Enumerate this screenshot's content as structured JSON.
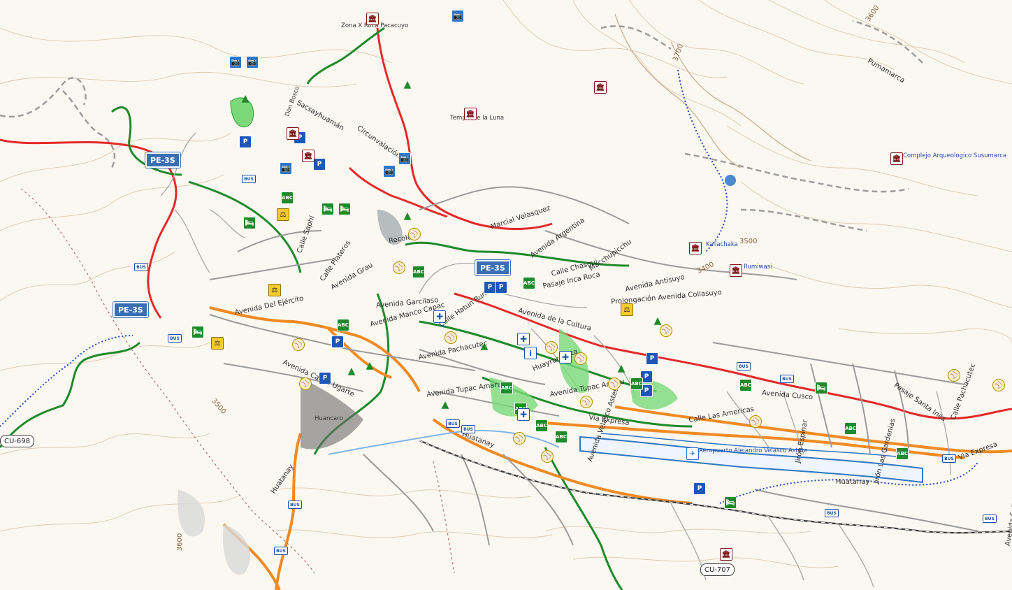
{
  "map": {
    "colors": {
      "background": "#fbf8f1",
      "contour": "#d9c3a7",
      "road_minor": "#9b9b9b",
      "road_green": "#1e8a2a",
      "road_orange": "#f08a24",
      "road_red": "#e4292a",
      "rail": "#3a3a3a",
      "water_blue": "#7fb6e8",
      "airport_blue": "#2e76c8"
    },
    "labels": {
      "zona": "Zona X Roca Pacacuyo",
      "don_bosco": "Don Bosco",
      "sacsayhuaman": "Sacsayhuamán",
      "circunvalacion": "Circunvalación",
      "templo_luna": "Templo de la Luna",
      "manuel_velasquez": "Marcial Velasquez",
      "av_argentina": "Avenida Argentina",
      "macchu_picchu": "Macchupicchu",
      "calle_chasqui": "Calle Chasqui",
      "pasaje_inca_roca": "Pasaje Inca Roca",
      "prolongacion_collasuyo": "Prolongación Avenida Collasuyo",
      "av_antisuyo": "Avenida Antisuyo",
      "av_del_ejercito": "Avenida Del Ejército",
      "av_carlos_ugarte": "Avenida Carlos Ugarte",
      "av_tupac_amaru": "Avenida Tupac Amaru",
      "av_de_la_cultura": "Avenida de la Cultura",
      "via_expresa": "Via Expresa",
      "calle_las_americas": "Calle Las Americas",
      "huatanay": "Huatanay",
      "aeropuerto": "Aeropuerto Alejandro Velasco Astete",
      "av_cusco": "Avenida Cusco",
      "av_sullimana": "Avenida Sullimana",
      "pumamarca": "Pumamarca",
      "complejo": "Complejo Arqueologico Susumarca",
      "kallachaka": "Kallachaka",
      "rumiwasi": "Rumiwasi",
      "recoleta": "Recoleta",
      "av_grau": "Avenida Grau",
      "av_manco_capac": "Avenida Manco Capac",
      "av_garcilaso": "Avenida Garcilaso",
      "av_huayruropata": "Huayruropata",
      "av_velasco_astete": "Avenida Velasco Astete",
      "jiron_espinar": "Jirón Espinar",
      "jiron_las_gardenias": "Jirón Las Gardenias",
      "pasaje_santa_ines": "Pasaje Santa Ines",
      "calle_pachacutec": "Calle Pachacutec",
      "av_pachacutec": "Avenida Pachacutec",
      "huancaro": "Huancaro",
      "calle_hatun_rumiyoq": "Calle Hatun Rumiyoq",
      "calle_saphi": "Calle Saphi",
      "calle_plateros": "Calle Plateros"
    },
    "contours": {
      "c3900": "3600",
      "c3700": "3700",
      "c3500": "3500",
      "c3400": "3400",
      "c3600": "3600",
      "c3500b": "3500"
    },
    "shields": {
      "pe3s_a": "PE-3S",
      "pe3s_b": "PE-3S",
      "pe3s_c": "PE-3S",
      "cu698": "CU-698",
      "cu707": "CU-707"
    },
    "icons": {
      "parking": "P",
      "school": "ABC",
      "museum": "🏛",
      "camera": "📷",
      "hospital": "✚",
      "bus": "BUS",
      "sport": "⚾",
      "tree": "▲",
      "hotel": "🛏",
      "gov": "⚖",
      "info": "i",
      "airport": "✈"
    }
  }
}
